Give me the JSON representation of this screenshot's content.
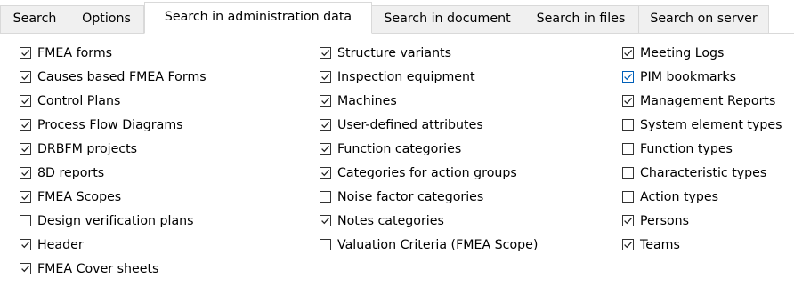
{
  "tabs": [
    {
      "label": "Search",
      "active": false
    },
    {
      "label": "Options",
      "active": false
    },
    {
      "label": "Search in administration data",
      "active": true
    },
    {
      "label": "Search in document",
      "active": false
    },
    {
      "label": "Search in files",
      "active": false
    },
    {
      "label": "Search on server",
      "active": false
    }
  ],
  "colors": {
    "checkbox_border": "#333333",
    "focused_checkbox_border": "#005fb8",
    "tab_inactive_bg": "#f0f0f0",
    "tab_border": "#d9d9d9"
  },
  "columns": [
    {
      "items": [
        {
          "label": "FMEA forms",
          "checked": true
        },
        {
          "label": "Causes based FMEA Forms",
          "checked": true
        },
        {
          "label": "Control Plans",
          "checked": true
        },
        {
          "label": "Process Flow Diagrams",
          "checked": true
        },
        {
          "label": "DRBFM projects",
          "checked": true
        },
        {
          "label": "8D reports",
          "checked": true
        },
        {
          "label": "FMEA Scopes",
          "checked": true
        },
        {
          "label": "Design verification plans",
          "checked": false
        },
        {
          "label": "Header",
          "checked": true
        },
        {
          "label": "FMEA Cover sheets",
          "checked": true
        }
      ]
    },
    {
      "items": [
        {
          "label": "Structure variants",
          "checked": true
        },
        {
          "label": "Inspection equipment",
          "checked": true
        },
        {
          "label": "Machines",
          "checked": true
        },
        {
          "label": "User-defined attributes",
          "checked": true
        },
        {
          "label": "Function categories",
          "checked": true
        },
        {
          "label": "Categories for action groups",
          "checked": true
        },
        {
          "label": "Noise factor categories",
          "checked": false
        },
        {
          "label": "Notes categories",
          "checked": true
        },
        {
          "label": "Valuation Criteria (FMEA Scope)",
          "checked": false
        }
      ]
    },
    {
      "items": [
        {
          "label": "Meeting Logs",
          "checked": true
        },
        {
          "label": "PIM bookmarks",
          "checked": true,
          "focused": true
        },
        {
          "label": "Management Reports",
          "checked": true
        },
        {
          "label": "System element types",
          "checked": false
        },
        {
          "label": "Function types",
          "checked": false
        },
        {
          "label": "Characteristic types",
          "checked": false
        },
        {
          "label": "Action types",
          "checked": false
        },
        {
          "label": "Persons",
          "checked": true
        },
        {
          "label": "Teams",
          "checked": true
        }
      ]
    }
  ]
}
